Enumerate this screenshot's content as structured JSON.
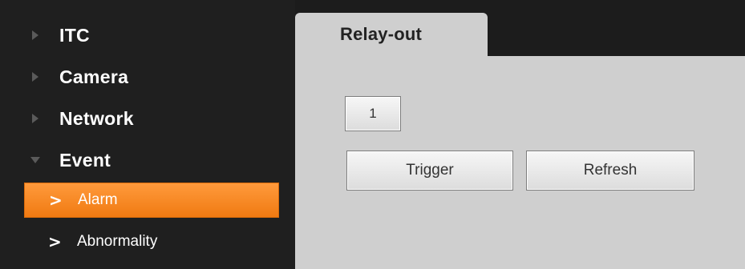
{
  "sidebar": {
    "items": [
      {
        "label": "ITC",
        "icon": "triangle-right-icon"
      },
      {
        "label": "Camera",
        "icon": "triangle-right-icon"
      },
      {
        "label": "Network",
        "icon": "triangle-right-icon"
      },
      {
        "label": "Event",
        "icon": "triangle-down-icon"
      }
    ],
    "subitems": [
      {
        "label": "Alarm",
        "icon": "chevron-right-icon",
        "active": true
      },
      {
        "label": "Abnormality",
        "icon": "chevron-right-icon",
        "active": false
      }
    ],
    "chevron_glyph": ">"
  },
  "main": {
    "tabs": [
      {
        "label": "Relay-out",
        "active": true
      }
    ],
    "channel_button": "1",
    "trigger_button": "Trigger",
    "refresh_button": "Refresh"
  },
  "colors": {
    "sidebar_bg": "#1f1f1f",
    "active_accent": "#f58a22",
    "panel_bg": "#cfcfcf"
  }
}
